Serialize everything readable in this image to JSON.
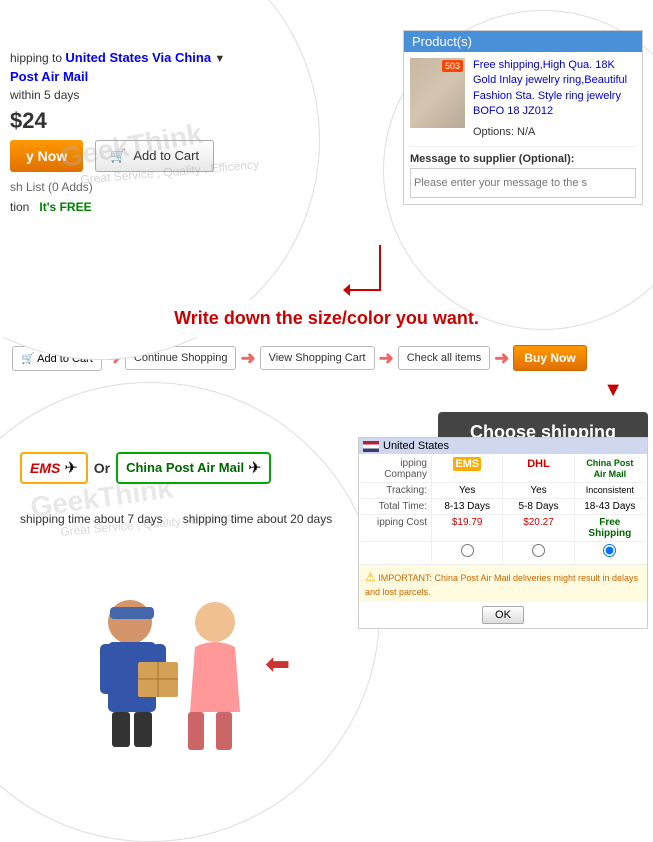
{
  "header": {
    "shipping_label": "hipping to",
    "shipping_destination": "United States Via China",
    "shipping_method": "Post Air Mail",
    "days_label": "within 5 days",
    "price": "24",
    "currency": "$"
  },
  "buttons": {
    "buy_now": "y Now",
    "add_to_cart": "Add to Cart",
    "wish_list": "sh List (0 Adds)",
    "protection": "tion",
    "its_free": "It's FREE"
  },
  "product": {
    "header": "Product(s)",
    "title": "Free shipping,High Qua. 18K Gold Inlay jewelry ring,Beautiful Fashion Sta. Style ring jewelry BOFO 18 JZ012",
    "options_label": "Options:",
    "options_value": "N/A",
    "badge": "503"
  },
  "message": {
    "label": "Message to supplier (Optional):",
    "placeholder": "Please enter your message to the s"
  },
  "write_down": {
    "text": "Write down the size/color you want."
  },
  "steps": [
    {
      "label": "Add to Cart"
    },
    {
      "label": "Continue Shopping"
    },
    {
      "label": "View Shopping Cart"
    },
    {
      "label": "Check all items"
    },
    {
      "label": "Buy Now"
    }
  ],
  "choose_shipping": {
    "label": "Choose shipping method"
  },
  "ems": {
    "logo": "EMS",
    "shipping_time": "shipping time about 7 days"
  },
  "china_post": {
    "label": "China Post Air Mail",
    "shipping_time": "shipping time about 20 days"
  },
  "watermark": {
    "main": "GeekThink",
    "sub": "Great Service , Quality , Efficency"
  },
  "shipping_table": {
    "country": "United States",
    "label_company": "ipping Company",
    "label_tracking": "Tracking:",
    "label_total_time": "Total Time:",
    "label_cost": "ipping Cost",
    "ems_tracking": "Yes",
    "ems_time": "8-13 Days",
    "ems_cost": "$19.79",
    "dhl_tracking": "Yes",
    "dhl_time": "5-8 Days",
    "dhl_cost": "$20.27",
    "china_tracking": "Inconsistent",
    "china_time": "18-43 Days",
    "china_cost": "Free Shipping",
    "important_note": "IMPORTANT: China Post Air Mail deliveries might result in delays and lost parcels."
  },
  "ok_btn": "OK"
}
